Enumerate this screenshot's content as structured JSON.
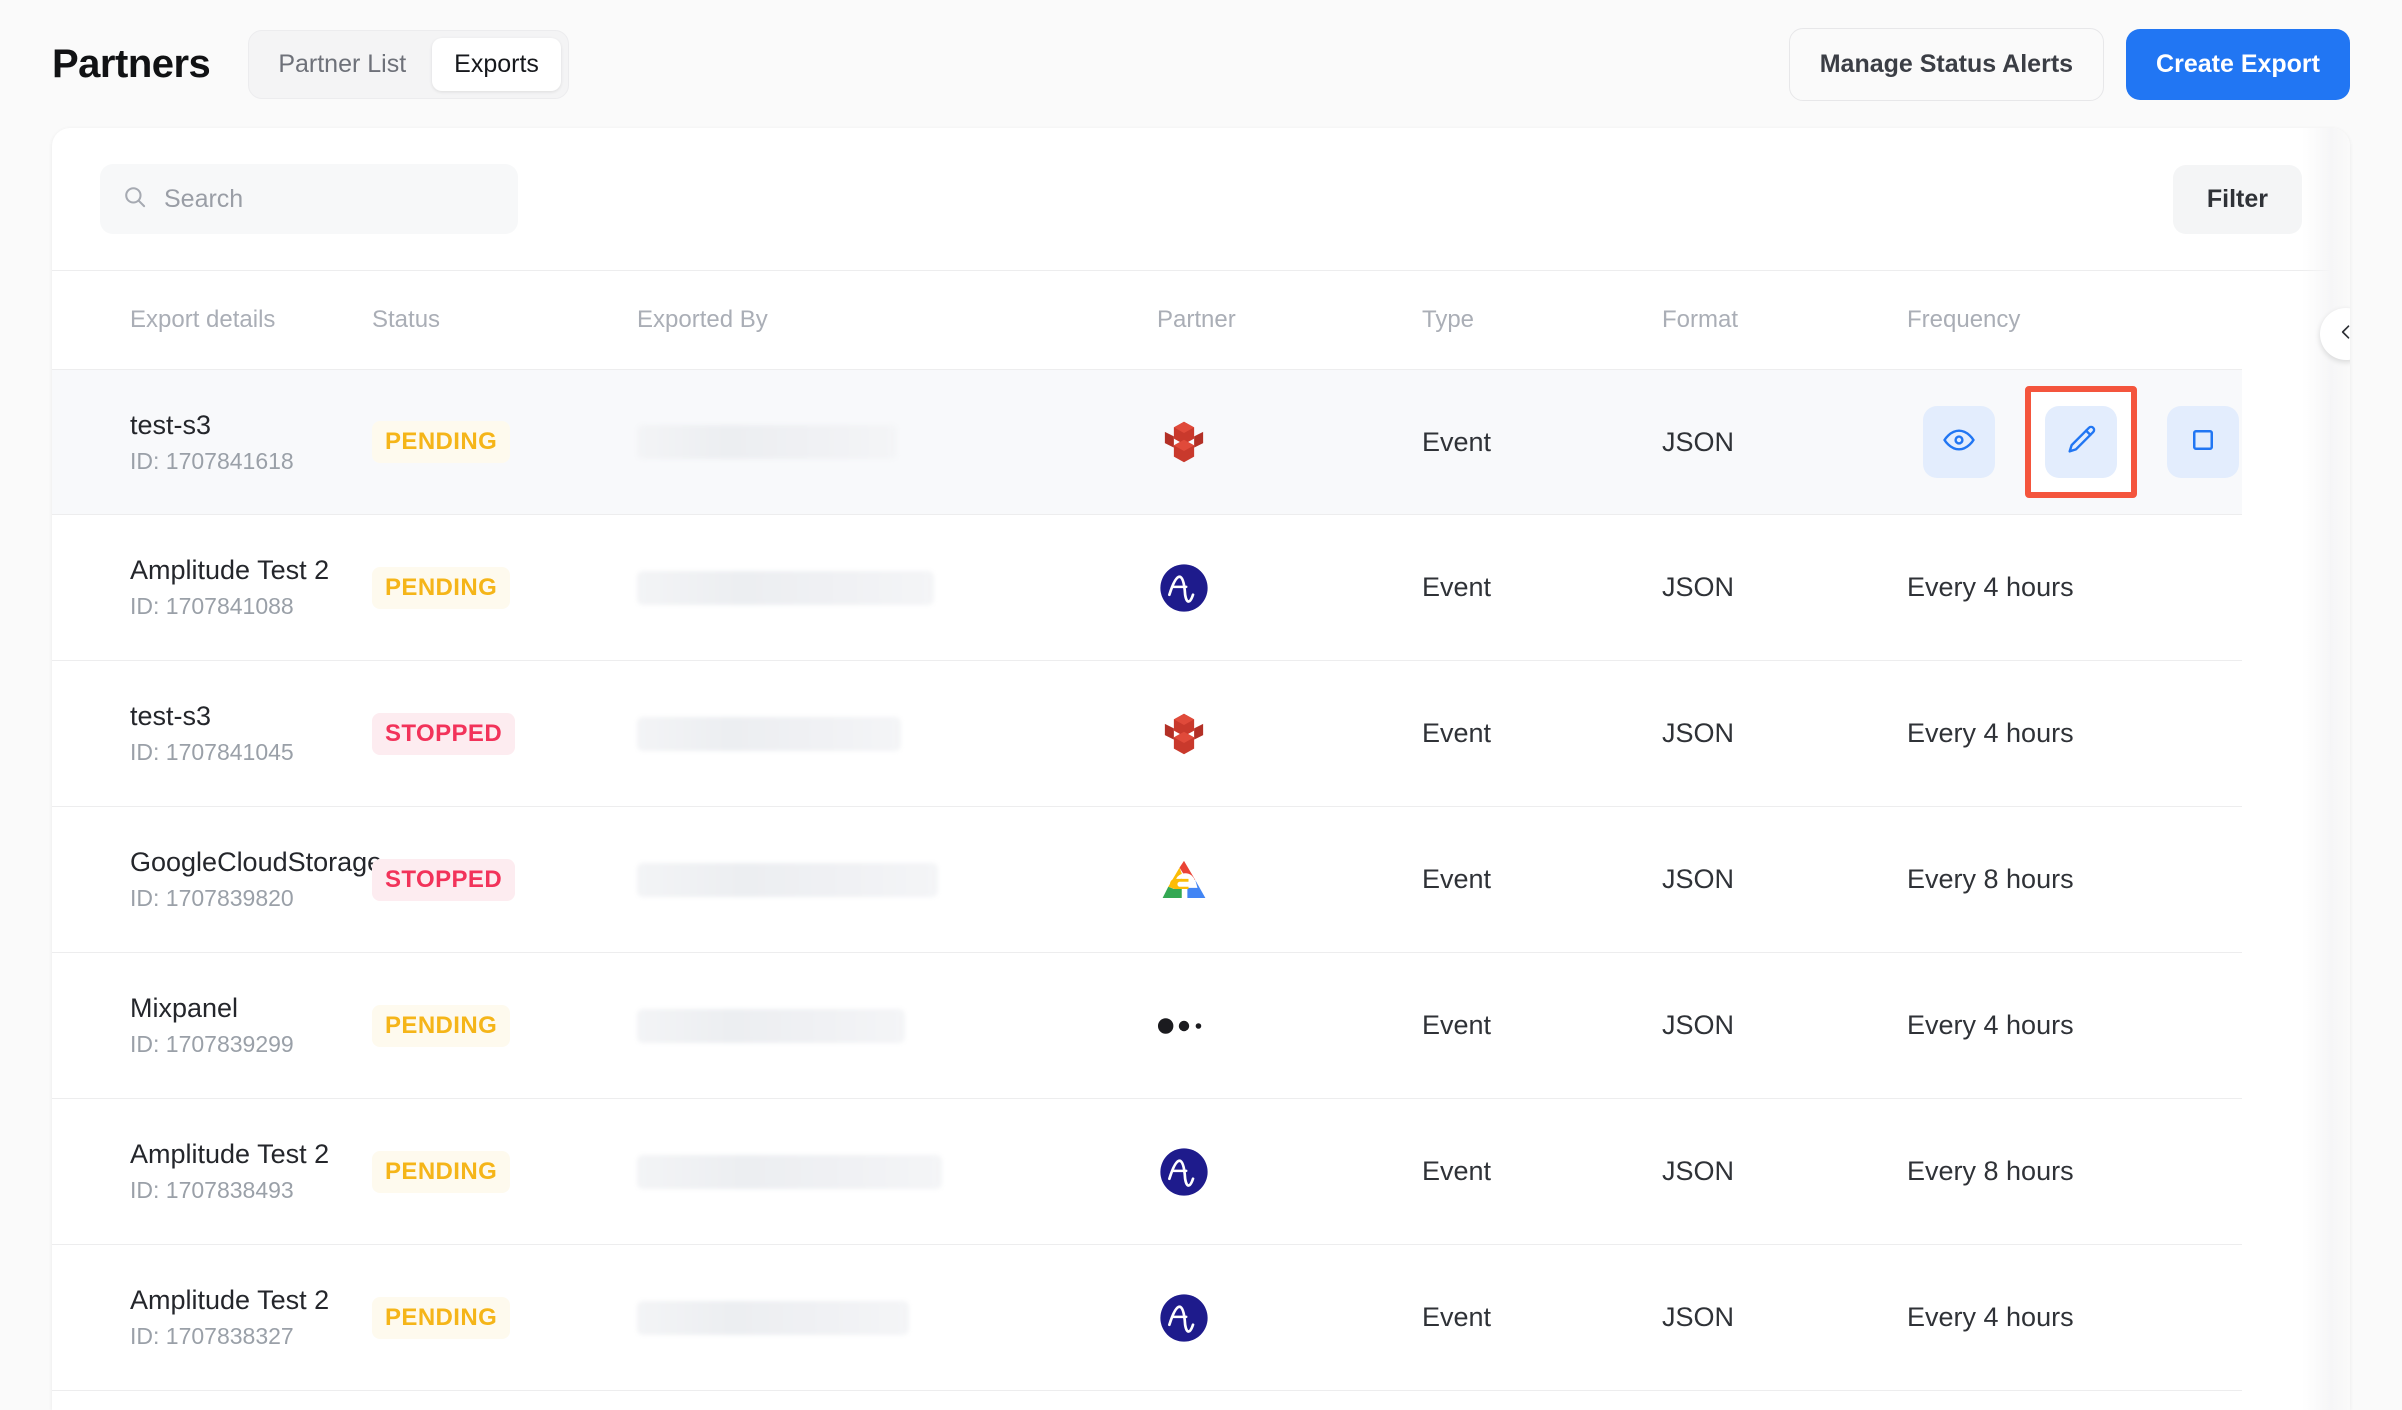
{
  "header": {
    "title": "Partners",
    "tabs": [
      {
        "label": "Partner List",
        "active": false
      },
      {
        "label": "Exports",
        "active": true
      }
    ],
    "manage_alerts_label": "Manage Status Alerts",
    "create_export_label": "Create Export"
  },
  "toolbar": {
    "search_placeholder": "Search",
    "filter_label": "Filter"
  },
  "table": {
    "columns": [
      "Export details",
      "Status",
      "Exported By",
      "Partner",
      "Type",
      "Format",
      "Frequency"
    ],
    "id_prefix": "ID: ",
    "rows": [
      {
        "name": "test-s3",
        "id": "ID: 1707841618",
        "status": "PENDING",
        "status_kind": "pending",
        "exported_by": "",
        "partner": "aws-s3",
        "type": "Event",
        "format": "JSON",
        "frequency": "",
        "selected": true,
        "actions": [
          "eye-icon",
          "pencil-icon",
          "stop-icon"
        ]
      },
      {
        "name": "Amplitude Test 2",
        "id": "ID: 1707841088",
        "status": "PENDING",
        "status_kind": "pending",
        "exported_by": "",
        "partner": "amplitude",
        "type": "Event",
        "format": "JSON",
        "frequency": "Every 4 hours",
        "selected": false,
        "actions": []
      },
      {
        "name": "test-s3",
        "id": "ID: 1707841045",
        "status": "STOPPED",
        "status_kind": "stopped",
        "exported_by": "",
        "partner": "aws-s3",
        "type": "Event",
        "format": "JSON",
        "frequency": "Every 4 hours",
        "selected": false,
        "actions": []
      },
      {
        "name": "GoogleCloudStorage",
        "id": "ID: 1707839820",
        "status": "STOPPED",
        "status_kind": "stopped",
        "exported_by": "",
        "partner": "google-cloud",
        "type": "Event",
        "format": "JSON",
        "frequency": "Every 8 hours",
        "selected": false,
        "actions": []
      },
      {
        "name": "Mixpanel",
        "id": "ID: 1707839299",
        "status": "PENDING",
        "status_kind": "pending",
        "exported_by": "",
        "partner": "mixpanel",
        "type": "Event",
        "format": "JSON",
        "frequency": "Every 4 hours",
        "selected": false,
        "actions": []
      },
      {
        "name": "Amplitude Test 2",
        "id": "ID: 1707838493",
        "status": "PENDING",
        "status_kind": "pending",
        "exported_by": "",
        "partner": "amplitude",
        "type": "Event",
        "format": "JSON",
        "frequency": "Every 8 hours",
        "selected": false,
        "actions": []
      },
      {
        "name": "Amplitude Test 2",
        "id": "ID: 1707838327",
        "status": "PENDING",
        "status_kind": "pending",
        "exported_by": "",
        "partner": "amplitude",
        "type": "Event",
        "format": "JSON",
        "frequency": "Every 4 hours",
        "selected": false,
        "actions": []
      }
    ]
  },
  "colors": {
    "primary": "#2176f3",
    "pending_text": "#f5b519",
    "pending_bg": "#fefaee",
    "stopped_text": "#f2335a",
    "stopped_bg": "#fdecf0",
    "action_bg": "#e3edfd",
    "highlight_border": "#f4553d"
  },
  "icons": {
    "search": "search-icon",
    "collapse": "chevron-left-icon",
    "view": "eye-icon",
    "edit": "pencil-icon",
    "stop": "stop-icon"
  }
}
